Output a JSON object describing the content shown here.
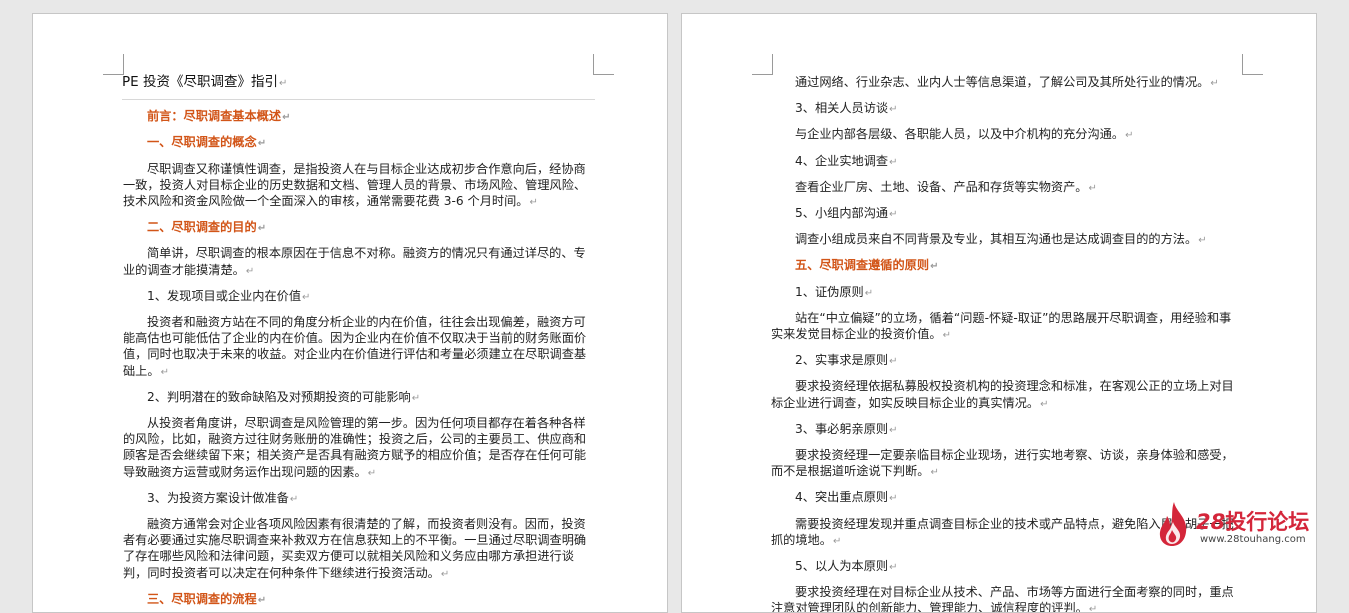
{
  "left": {
    "title": "PE 投资《尽职调查》指引",
    "paras": [
      {
        "type": "head",
        "text": "前言：尽职调查基本概述"
      },
      {
        "type": "head",
        "text": "一、尽职调查的概念"
      },
      {
        "type": "para",
        "text": "尽职调查又称谨慎性调查，是指投资人在与目标企业达成初步合作意向后，经协商一致，投资人对目标企业的历史数据和文档、管理人员的背景、市场风险、管理风险、技术风险和资金风险做一个全面深入的审核，通常需要花费 3-6 个月时间。"
      },
      {
        "type": "head",
        "text": "二、尽职调查的目的"
      },
      {
        "type": "para",
        "text": "简单讲，尽职调查的根本原因在于信息不对称。融资方的情况只有通过详尽的、专业的调查才能摸清楚。"
      },
      {
        "type": "sub",
        "text": "1、发现项目或企业内在价值"
      },
      {
        "type": "para",
        "text": "投资者和融资方站在不同的角度分析企业的内在价值，往往会出现偏差，融资方可能高估也可能低估了企业的内在价值。因为企业内在价值不仅取决于当前的财务账面价值，同时也取决于未来的收益。对企业内在价值进行评估和考量必须建立在尽职调查基础上。"
      },
      {
        "type": "sub",
        "text": "2、判明潜在的致命缺陷及对预期投资的可能影响"
      },
      {
        "type": "para",
        "text": "从投资者角度讲，尽职调查是风险管理的第一步。因为任何项目都存在着各种各样的风险，比如，融资方过往财务账册的准确性；投资之后，公司的主要员工、供应商和顾客是否会继续留下来；相关资产是否具有融资方赋予的相应价值；是否存在任何可能导致融资方运营或财务运作出现问题的因素。"
      },
      {
        "type": "sub",
        "text": "3、为投资方案设计做准备"
      },
      {
        "type": "para",
        "text": "融资方通常会对企业各项风险因素有很清楚的了解，而投资者则没有。因而，投资者有必要通过实施尽职调查来补救双方在信息获知上的不平衡。一旦通过尽职调查明确了存在哪些风险和法律问题，买卖双方便可以就相关风险和义务应由哪方承担进行谈判，同时投资者可以决定在何种条件下继续进行投资活动。"
      },
      {
        "type": "head",
        "text": "三、尽职调查的流程"
      }
    ]
  },
  "right": {
    "paras": [
      {
        "type": "sub",
        "text": "通过网络、行业杂志、业内人士等信息渠道，了解公司及其所处行业的情况。"
      },
      {
        "type": "sub",
        "text": "3、相关人员访谈"
      },
      {
        "type": "sub",
        "text": "与企业内部各层级、各职能人员，以及中介机构的充分沟通。"
      },
      {
        "type": "sub",
        "text": "4、企业实地调查"
      },
      {
        "type": "sub",
        "text": "查看企业厂房、土地、设备、产品和存货等实物资产。"
      },
      {
        "type": "sub",
        "text": "5、小组内部沟通"
      },
      {
        "type": "sub",
        "text": "调查小组成员来自不同背景及专业，其相互沟通也是达成调查目的的方法。"
      },
      {
        "type": "head",
        "text": "五、尽职调查遵循的原则"
      },
      {
        "type": "sub",
        "text": "1、证伪原则"
      },
      {
        "type": "para",
        "text": "站在“中立偏疑”的立场，循着“问题-怀疑-取证”的思路展开尽职调查，用经验和事实来发觉目标企业的投资价值。"
      },
      {
        "type": "sub",
        "text": "2、实事求是原则"
      },
      {
        "type": "para",
        "text": "要求投资经理依据私募股权投资机构的投资理念和标准，在客观公正的立场上对目标企业进行调查，如实反映目标企业的真实情况。"
      },
      {
        "type": "sub",
        "text": "3、事必躬亲原则"
      },
      {
        "type": "para",
        "text": "要求投资经理一定要亲临目标企业现场，进行实地考察、访谈，亲身体验和感受，而不是根据道听途说下判断。"
      },
      {
        "type": "sub",
        "text": "4、突出重点原则"
      },
      {
        "type": "para",
        "text": "需要投资经理发现并重点调查目标企业的技术或产品特点，避免陷入眉毛胡子一把抓的境地。"
      },
      {
        "type": "sub",
        "text": "5、以人为本原则"
      },
      {
        "type": "para",
        "text": "要求投资经理在对目标企业从技术、产品、市场等方面进行全面考察的同时，重点注意对管理团队的创新能力、管理能力、诚信程度的评判。"
      }
    ]
  },
  "logo": {
    "number": "28",
    "name": "投行论坛",
    "url": "www.28touhang.com"
  },
  "paragraph_mark": "↵",
  "colors": {
    "heading": "#d25518",
    "logo": "#d4263a"
  }
}
